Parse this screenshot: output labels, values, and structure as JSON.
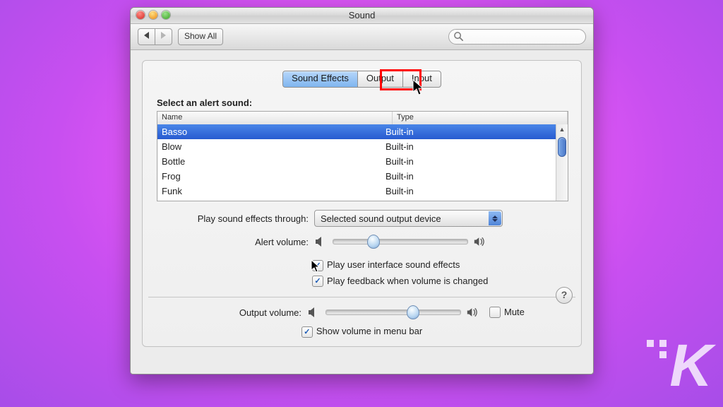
{
  "window": {
    "title": "Sound"
  },
  "toolbar": {
    "show_all": "Show All",
    "search_placeholder": ""
  },
  "tabs": [
    {
      "id": "sound-effects",
      "label": "Sound Effects",
      "selected": true
    },
    {
      "id": "output",
      "label": "Output",
      "selected": false,
      "highlighted": true
    },
    {
      "id": "input",
      "label": "Input",
      "selected": false
    }
  ],
  "alert_sounds": {
    "heading": "Select an alert sound:",
    "columns": {
      "name": "Name",
      "type": "Type"
    },
    "rows": [
      {
        "name": "Basso",
        "type": "Built-in",
        "selected": true
      },
      {
        "name": "Blow",
        "type": "Built-in"
      },
      {
        "name": "Bottle",
        "type": "Built-in"
      },
      {
        "name": "Frog",
        "type": "Built-in"
      },
      {
        "name": "Funk",
        "type": "Built-in"
      }
    ]
  },
  "effects_through": {
    "label": "Play sound effects through:",
    "value": "Selected sound output device"
  },
  "alert_volume": {
    "label": "Alert volume:",
    "percent": 25
  },
  "checkboxes": {
    "ui_effects": {
      "label": "Play user interface sound effects",
      "checked": true
    },
    "feedback": {
      "label": "Play feedback when volume is changed",
      "checked": true
    },
    "mute": {
      "label": "Mute",
      "checked": false
    },
    "menu_bar": {
      "label": "Show volume in menu bar",
      "checked": true
    }
  },
  "output_volume": {
    "label": "Output volume:",
    "percent": 60
  },
  "help_label": "?"
}
